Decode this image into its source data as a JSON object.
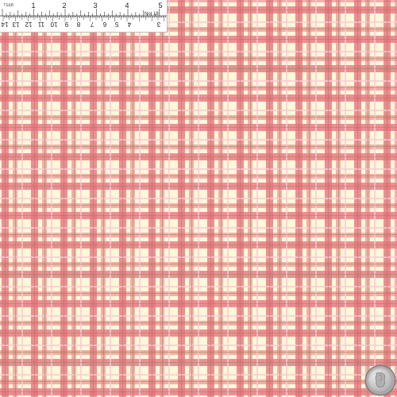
{
  "fabric": {
    "pattern_name": "plaid-icon",
    "colors": {
      "background": "#fdf8d8",
      "rose_band": "#e87082",
      "light_pink_stripe": "#ffc8d7",
      "olive_pinstripe": "#968c3c"
    }
  },
  "ruler": {
    "icon": "ruler-icon",
    "maker_mark": "TS&B",
    "number_label": "No. 18",
    "inch_labels": [
      "1",
      "2",
      "3",
      "4",
      "5"
    ],
    "cm_labels": [
      "14",
      "13",
      "12",
      "11",
      "10",
      "9",
      "8",
      "7",
      "6",
      "5",
      "4",
      "3"
    ]
  },
  "coin": {
    "icon": "quarter-coin-icon"
  }
}
